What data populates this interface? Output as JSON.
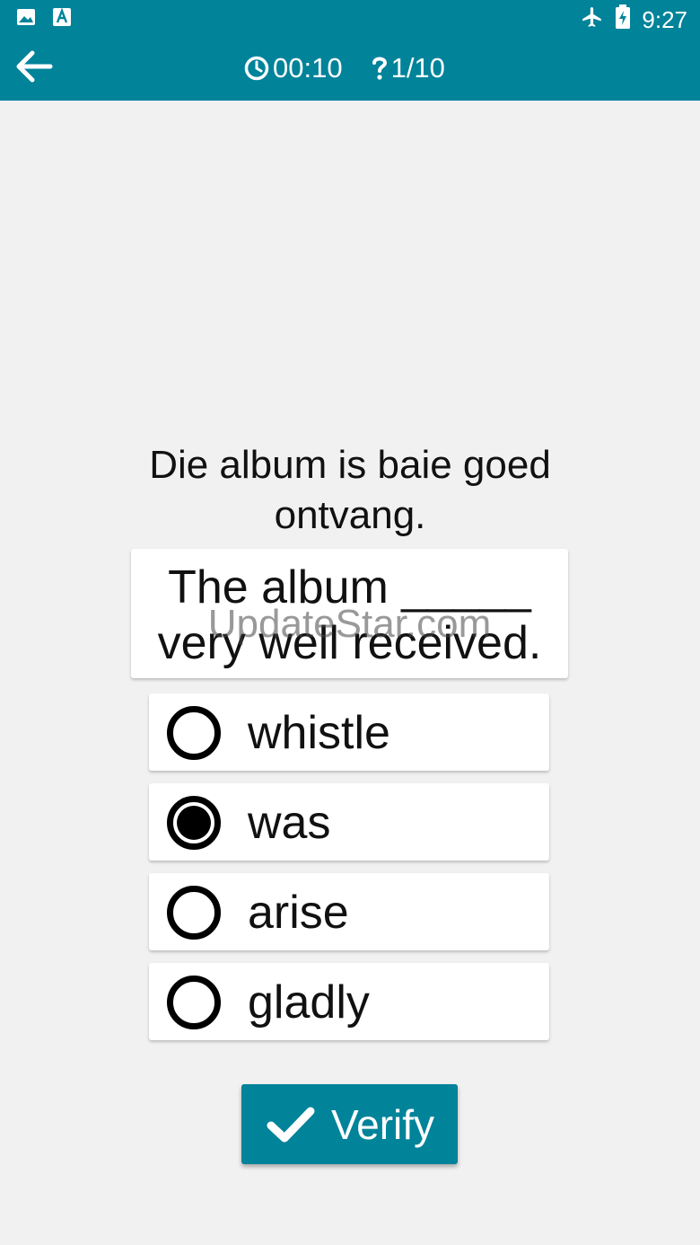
{
  "status_bar": {
    "time": "9:27",
    "left_icons": [
      "image-icon",
      "text-icon"
    ],
    "right_icons": [
      "airplane-icon",
      "battery-charging-icon"
    ]
  },
  "header": {
    "timer": "00:10",
    "progress": "1/10"
  },
  "question": {
    "prompt": "Die album is baie goed ontvang.",
    "sentence": "The album _____ very well received."
  },
  "watermark": "UpdateStar.com",
  "options": [
    {
      "label": "whistle",
      "selected": false
    },
    {
      "label": "was",
      "selected": true
    },
    {
      "label": "arise",
      "selected": false
    },
    {
      "label": "gladly",
      "selected": false
    }
  ],
  "verify_button": {
    "label": "Verify"
  },
  "colors": {
    "primary": "#01839a",
    "background": "#f1f1f1"
  }
}
